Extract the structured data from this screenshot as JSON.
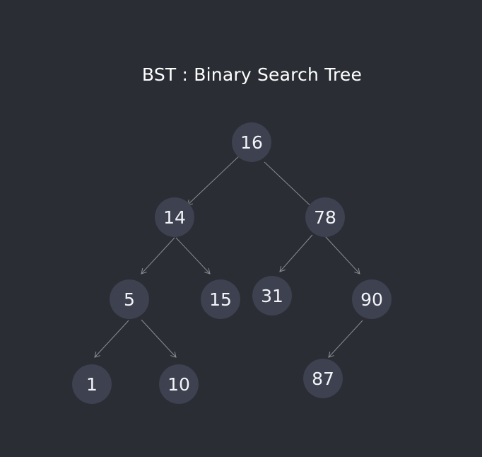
{
  "title": "BST : Binary Search Tree",
  "colors": {
    "background": "#2a2d33",
    "node_fill": "#3d4150",
    "node_text": "#f3f4f7",
    "edge": "#8a8d94"
  },
  "tree": {
    "nodes": [
      {
        "id": "n16",
        "label": "16"
      },
      {
        "id": "n14",
        "label": "14"
      },
      {
        "id": "n78",
        "label": "78"
      },
      {
        "id": "n5",
        "label": "5"
      },
      {
        "id": "n15",
        "label": "15"
      },
      {
        "id": "n31",
        "label": "31"
      },
      {
        "id": "n90",
        "label": "90"
      },
      {
        "id": "n1",
        "label": "1"
      },
      {
        "id": "n10",
        "label": "10"
      },
      {
        "id": "n87",
        "label": "87"
      }
    ],
    "edges": [
      {
        "from": "n16",
        "to": "n14"
      },
      {
        "from": "n16",
        "to": "n78"
      },
      {
        "from": "n14",
        "to": "n5"
      },
      {
        "from": "n14",
        "to": "n15"
      },
      {
        "from": "n78",
        "to": "n31"
      },
      {
        "from": "n78",
        "to": "n90"
      },
      {
        "from": "n5",
        "to": "n1"
      },
      {
        "from": "n5",
        "to": "n10"
      },
      {
        "from": "n90",
        "to": "n87"
      }
    ]
  }
}
